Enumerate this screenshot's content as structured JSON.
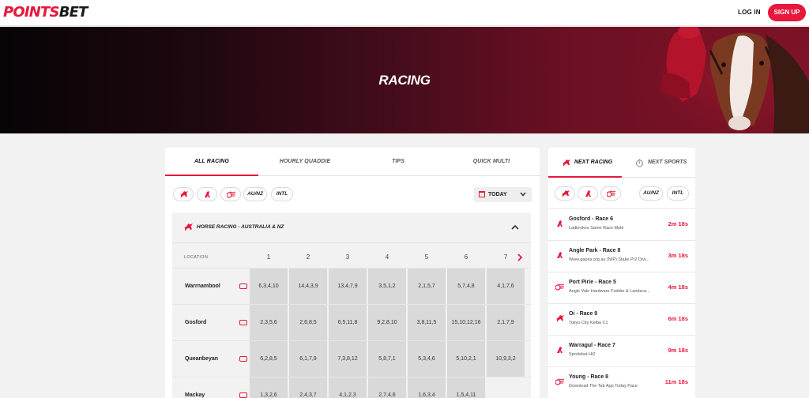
{
  "header": {
    "logo_part1": "POINTS",
    "logo_part2": "BET",
    "login_label": "LOG IN",
    "signup_label": "SIGN UP"
  },
  "hero": {
    "title": "RACING"
  },
  "main": {
    "tabs": [
      {
        "label": "ALL RACING",
        "active": true
      },
      {
        "label": "HOURLY QUADDIE",
        "active": false
      },
      {
        "label": "TIPS",
        "active": false
      },
      {
        "label": "QUICK MULTI",
        "active": false
      }
    ],
    "filters": {
      "type_icons": [
        "horse-racing-icon",
        "greyhound-racing-icon",
        "harness-racing-icon"
      ],
      "region_buttons": [
        "AU/NZ",
        "INTL"
      ],
      "date_select": "TODAY"
    },
    "section": {
      "title": "HORSE RACING - AUSTRALIA & NZ",
      "location_label": "LOCATION",
      "race_numbers": [
        "1",
        "2",
        "3",
        "4",
        "5",
        "6",
        "7"
      ],
      "rows": [
        {
          "venue": "Warrnambool",
          "results": [
            "6,3,4,10",
            "14,4,3,9",
            "13,4,7,9",
            "3,5,1,2",
            "2,1,5,7",
            "5,7,4,8",
            "4,1,7,6"
          ]
        },
        {
          "venue": "Gosford",
          "results": [
            "2,3,5,6",
            "2,6,8,5",
            "6,5,11,8",
            "9,2,8,10",
            "3,8,11,5",
            "15,10,12,16",
            "2,1,7,9"
          ]
        },
        {
          "venue": "Queanbeyan",
          "results": [
            "6,2,8,5",
            "6,1,7,9",
            "7,3,8,12",
            "5,8,7,1",
            "5,3,4,6",
            "5,10,2,1",
            "10,9,3,2"
          ]
        },
        {
          "venue": "Mackay",
          "results": [
            "1,3,2,6",
            "2,4,3,7",
            "4,1,2,3",
            "2,7,4,6",
            "1,6,3,4",
            "1,5,4,11",
            ""
          ]
        }
      ]
    }
  },
  "side": {
    "tabs": [
      {
        "label": "NEXT RACING",
        "icon": "horse-racing-icon",
        "active": true
      },
      {
        "label": "NEXT SPORTS",
        "icon": "stopwatch-icon",
        "active": false
      }
    ],
    "filters": {
      "type_icons": [
        "horse-racing-icon",
        "greyhound-racing-icon",
        "harness-racing-icon"
      ],
      "region_buttons": [
        "AU/NZ",
        "INTL"
      ]
    },
    "races": [
      {
        "name": "Gosford - Race 6",
        "sub": "Ladbrokes Same Race Multi",
        "time": "2m 18s",
        "type": "greyhound"
      },
      {
        "name": "Angle Park - Race 8",
        "sub": "Www.gapsa.org.au (N/P) Stake Pr2 Divi...",
        "time": "3m 18s",
        "type": "greyhound"
      },
      {
        "name": "Port Pirie - Race 5",
        "sub": "Angle Vale Hardware Fodder & Landsca...",
        "time": "4m 18s",
        "type": "harness"
      },
      {
        "name": "Oi - Race 9",
        "sub": "Tokyo City Keiba C1",
        "time": "6m 18s",
        "type": "horse"
      },
      {
        "name": "Warragul - Race 7",
        "sub": "Sportsbet Ht2",
        "time": "9m 18s",
        "type": "greyhound"
      },
      {
        "name": "Young - Race 8",
        "sub": "Download The Tab App Today Pace",
        "time": "11m 18s",
        "type": "harness"
      }
    ]
  },
  "colors": {
    "accent": "#e8173c",
    "hero_dark": "#070406",
    "hero_red": "#7c1226"
  }
}
